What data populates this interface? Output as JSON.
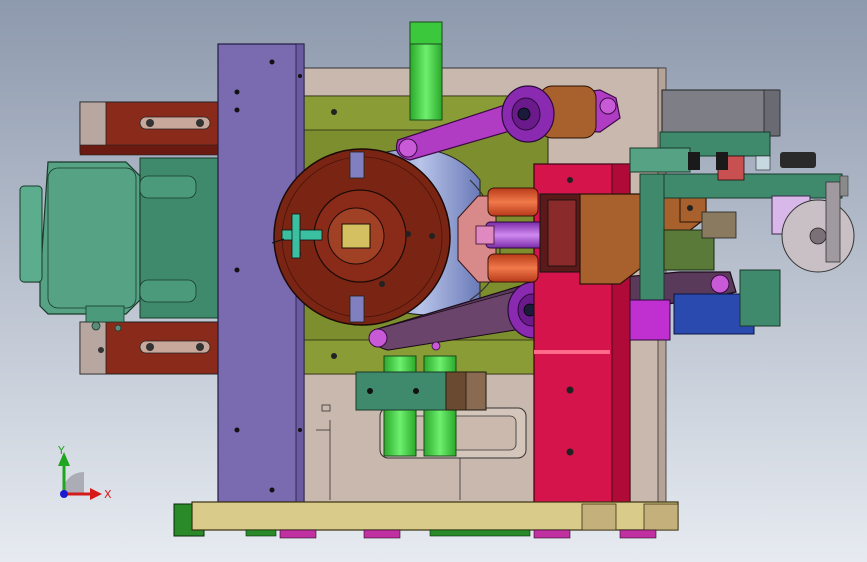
{
  "viewport": {
    "background_top": "#8d99ad",
    "background_bottom": "#e7ebf1"
  },
  "triad": {
    "x_label": "X",
    "y_label": "Y",
    "x_color": "#d51a1a",
    "y_color": "#1fa51f",
    "z_color": "#1a1ad1"
  },
  "colors": {
    "frame_plate": "#c9b8ad",
    "purple_plate": "#7a6ab0",
    "olive_block": "#7c8e2e",
    "chuck_red": "#7a2414",
    "motor_green": "#55a284",
    "green_shaft": "#3fd43f",
    "magenta_arm": "#b13cc4",
    "crimson_column": "#d4144a",
    "brown_bracket": "#a8602c",
    "base_tan": "#d9cc8a",
    "grey_box": "#7e7e86"
  }
}
